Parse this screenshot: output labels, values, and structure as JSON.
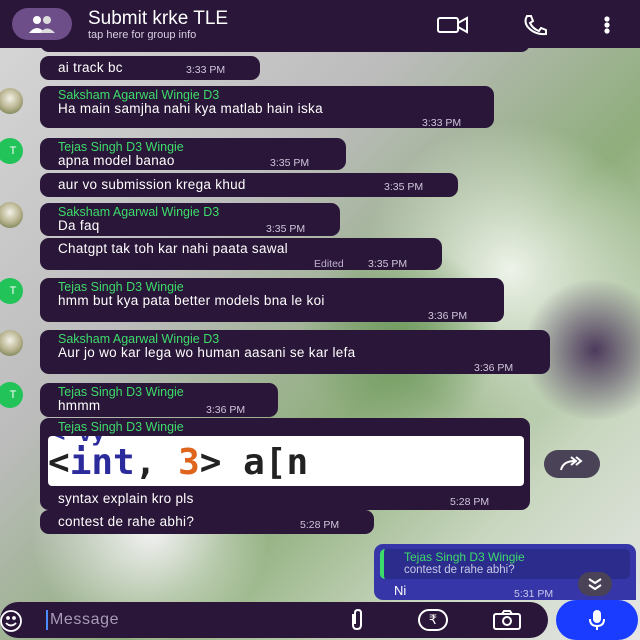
{
  "header": {
    "title": "Submit krke TLE",
    "subtitle": "tap here for group info"
  },
  "messages": [
    {
      "text": "ai track bc",
      "time": "3:33 PM"
    },
    {
      "sender": "Saksham Agarwal Wingie D3",
      "text": "Ha main samjha nahi kya matlab hain iska",
      "time": "3:33 PM"
    },
    {
      "sender": "Tejas Singh D3 Wingie",
      "text": "apna model banao",
      "time": "3:35 PM"
    },
    {
      "text": "aur vo submission krega khud",
      "time": "3:35 PM"
    },
    {
      "sender": "Saksham Agarwal Wingie D3",
      "text": "Da faq",
      "time": "3:35 PM"
    },
    {
      "text": "Chatgpt tak toh kar nahi paata sawal",
      "edited": "Edited",
      "time": "3:35 PM"
    },
    {
      "sender": "Tejas Singh D3 Wingie",
      "text": "hmm but kya pata better models bna le koi",
      "time": "3:36 PM"
    },
    {
      "sender": "Saksham Agarwal Wingie D3",
      "text": "Aur jo wo kar lega wo human aasani se kar lefa",
      "time": "3:36 PM"
    },
    {
      "sender": "Tejas Singh D3 Wingie",
      "text": "hmmm",
      "time": "3:36 PM"
    },
    {
      "sender": "Tejas Singh D3 Wingie",
      "text": "syntax explain kro pls",
      "time": "5:28 PM"
    },
    {
      "text": "contest de rahe abhi?",
      "time": "5:28 PM"
    }
  ],
  "code_image": {
    "top_fragment": "< vy",
    "open": "<",
    "keyword": "int",
    "comma": ", ",
    "number": "3",
    "close": "> a[n"
  },
  "avatars": {
    "tejas_initial": "T"
  },
  "outgoing": {
    "quote_sender": "Tejas Singh D3 Wingie",
    "quote_text": "contest de rahe abhi?",
    "text": "Ni",
    "time": "5:31 PM"
  },
  "input": {
    "placeholder": "Message",
    "rupee_symbol": "₹"
  },
  "colors": {
    "bubble": "#2a1638",
    "outgoing_bubble": "#3636a8",
    "sender_name": "#3ddc6a",
    "mic_button": "#1a3cff"
  },
  "icons": [
    "group-icon",
    "video-call-icon",
    "phone-icon",
    "more-icon",
    "forward-icon",
    "scroll-down-icon",
    "emoji-icon",
    "attach-icon",
    "rupee-icon",
    "camera-icon",
    "mic-icon"
  ]
}
